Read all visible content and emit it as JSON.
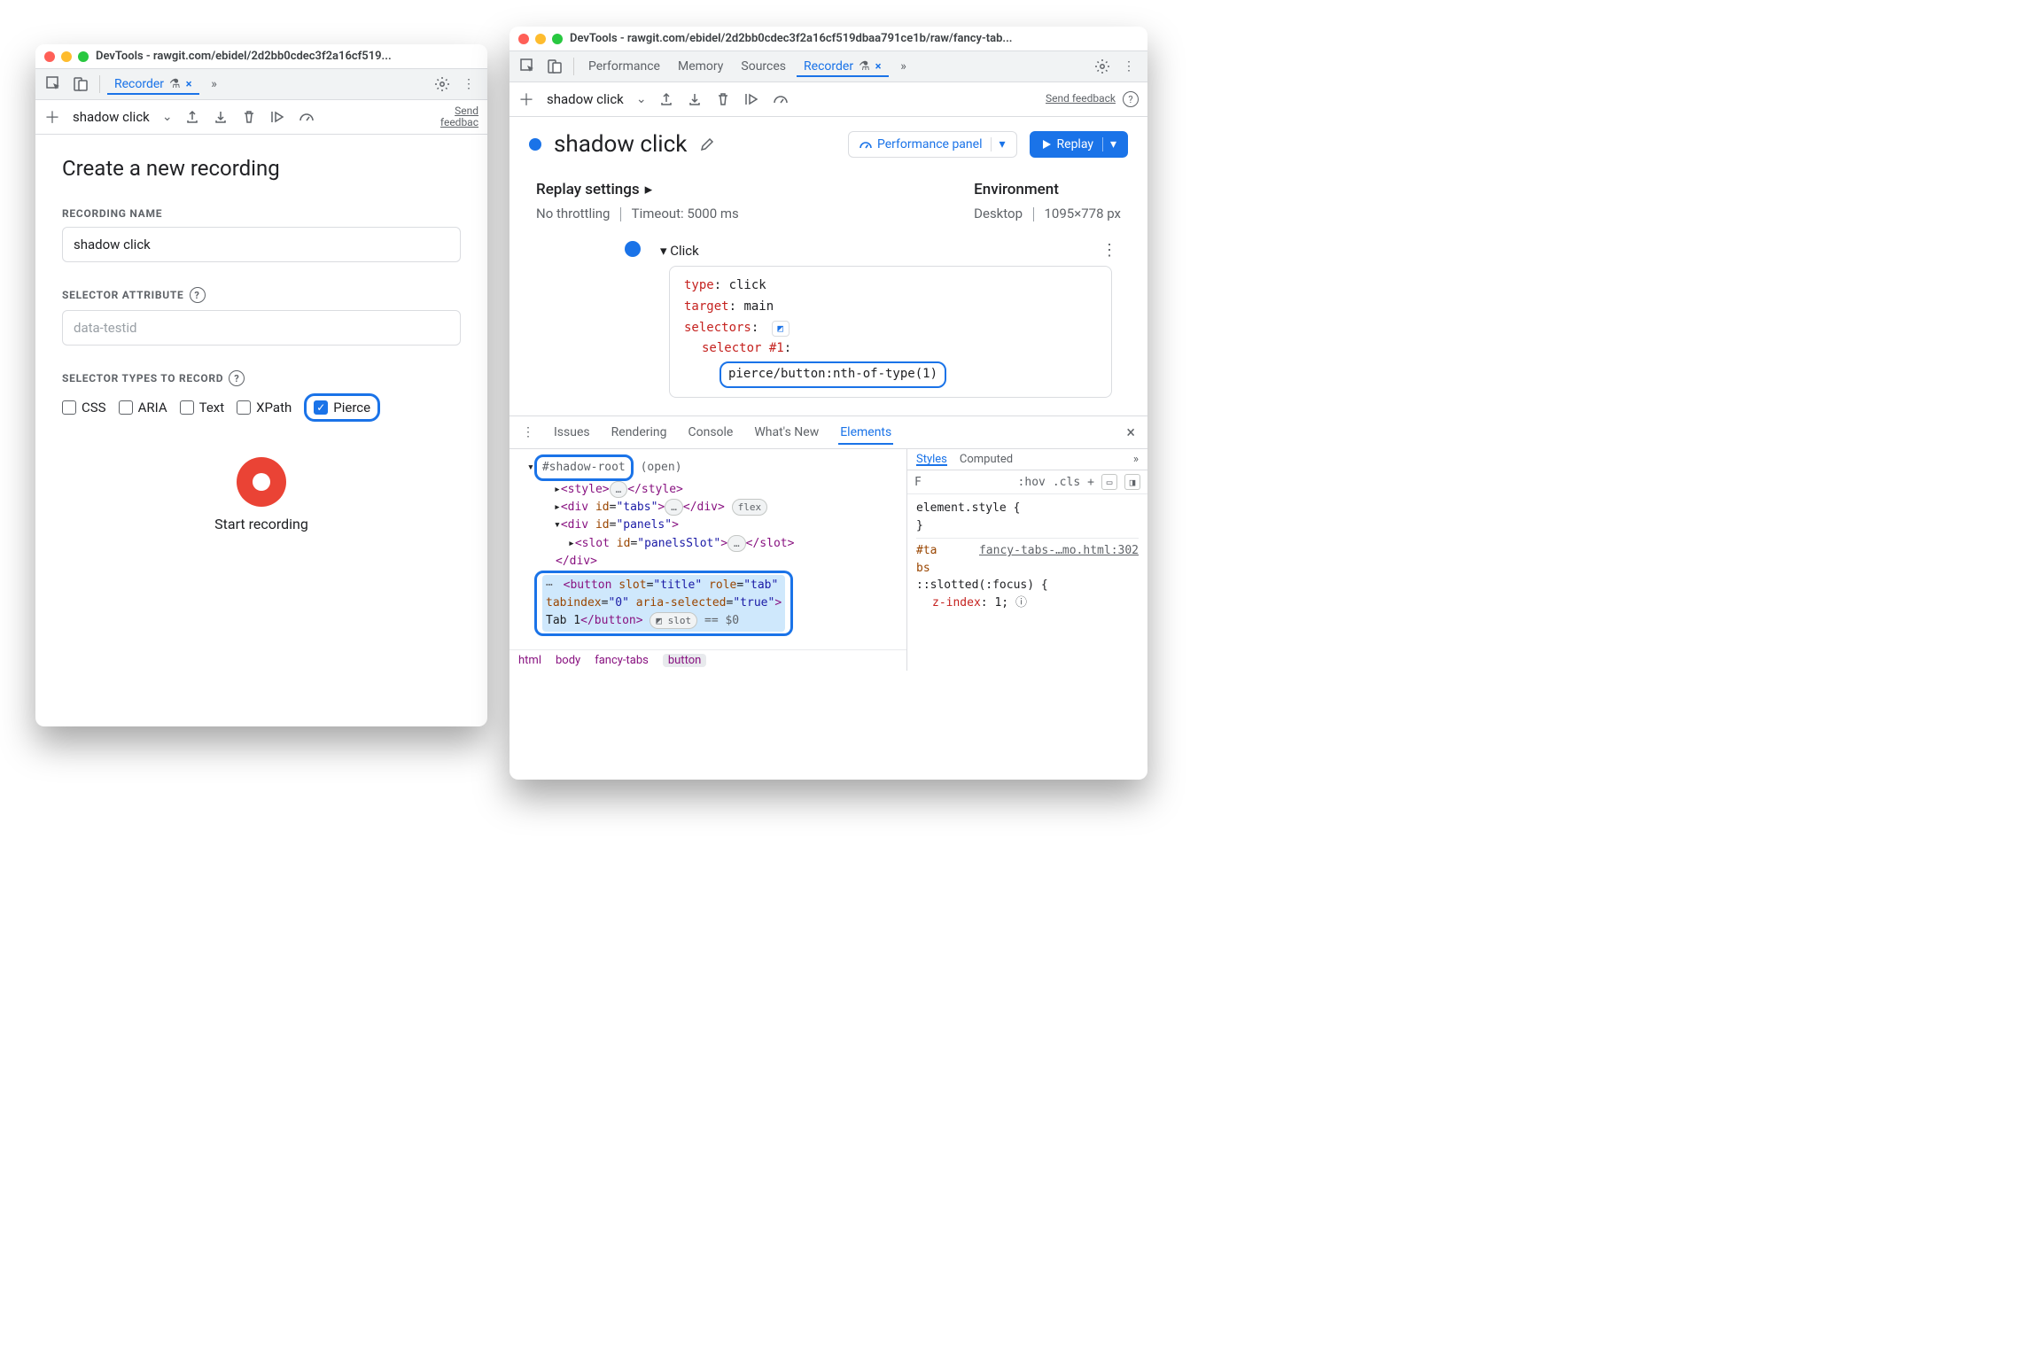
{
  "leftWindow": {
    "title": "DevTools - rawgit.com/ebidel/2d2bb0cdec3f2a16cf519...",
    "tab": {
      "label": "Recorder",
      "flask": "⚗",
      "close": "×",
      "overflow": "»"
    },
    "toolbar": {
      "recording_name": "shadow click",
      "send_feedback": "Send\nfeedbac"
    },
    "create": {
      "heading": "Create a new recording",
      "name_label": "RECORDING NAME",
      "name_value": "shadow click",
      "attr_label": "SELECTOR ATTRIBUTE",
      "attr_placeholder": "data-testid",
      "types_label": "SELECTOR TYPES TO RECORD",
      "types": [
        {
          "label": "CSS",
          "checked": false
        },
        {
          "label": "ARIA",
          "checked": false
        },
        {
          "label": "Text",
          "checked": false
        },
        {
          "label": "XPath",
          "checked": false
        },
        {
          "label": "Pierce",
          "checked": true
        }
      ],
      "start_label": "Start recording"
    }
  },
  "rightWindow": {
    "title": "DevTools - rawgit.com/ebidel/2d2bb0cdec3f2a16cf519dbaa791ce1b/raw/fancy-tab...",
    "tabs": {
      "items": [
        "Performance",
        "Memory",
        "Sources"
      ],
      "active": {
        "label": "Recorder",
        "close": "×"
      },
      "overflow": "»"
    },
    "toolbar": {
      "recording_name": "shadow click",
      "send_feedback": "Send feedback"
    },
    "detail": {
      "title": "shadow click",
      "perf_button": "Performance panel",
      "replay_button": "Replay",
      "replay_settings_label": "Replay settings",
      "throttling": "No throttling",
      "timeout": "Timeout: 5000 ms",
      "env_label": "Environment",
      "env_device": "Desktop",
      "env_size": "1095×778 px",
      "step": {
        "label": "Click",
        "type_k": "type",
        "type_v": "click",
        "target_k": "target",
        "target_v": "main",
        "selectors_k": "selectors",
        "sel1_label": "selector #1",
        "sel1_value": "pierce/button:nth-of-type(1)"
      }
    },
    "drawer": {
      "tabs": [
        "Issues",
        "Rendering",
        "Console",
        "What's New",
        "Elements"
      ],
      "active": "Elements",
      "elements": {
        "shadow_root": "#shadow-root",
        "shadow_mode": "(open)",
        "line_style": "<style>…</style>",
        "div_tabs_pre": "<div id=\"",
        "div_tabs_id": "tabs",
        "div_tabs_post": "\">…</div>",
        "flex_badge": "flex",
        "div_panels_pre": "<div id=\"",
        "div_panels_id": "panels",
        "div_panels_post": "\">",
        "slot_pre": "<slot id=\"",
        "slot_id": "panelsSlot",
        "slot_post": "\">…</slot>",
        "div_close": "</div>",
        "btn_line1": "<button slot=\"title\" role=\"tab\"",
        "btn_line2": "tabindex=\"0\" aria-selected=\"true\">",
        "btn_line3_text": "Tab 1",
        "btn_line3_close": "</button>",
        "slot_badge": "slot",
        "eq0": "== $0"
      },
      "crumbs": [
        "html",
        "body",
        "fancy-tabs",
        "button"
      ],
      "styles": {
        "tabs": [
          "Styles",
          "Computed"
        ],
        "overflow": "»",
        "filter_char": "F",
        "hov": ":hov",
        "cls": ".cls",
        "plus": "+",
        "elstyle_open": "element.style {",
        "close_brace": "}",
        "sel1": "#ta",
        "sel1_cont": "bs",
        "source": "fancy-tabs-…mo.html:302",
        "rule2": "::slotted(:focus) {",
        "prop": "z-index",
        "val": "1",
        "info": "ⓘ"
      }
    }
  }
}
